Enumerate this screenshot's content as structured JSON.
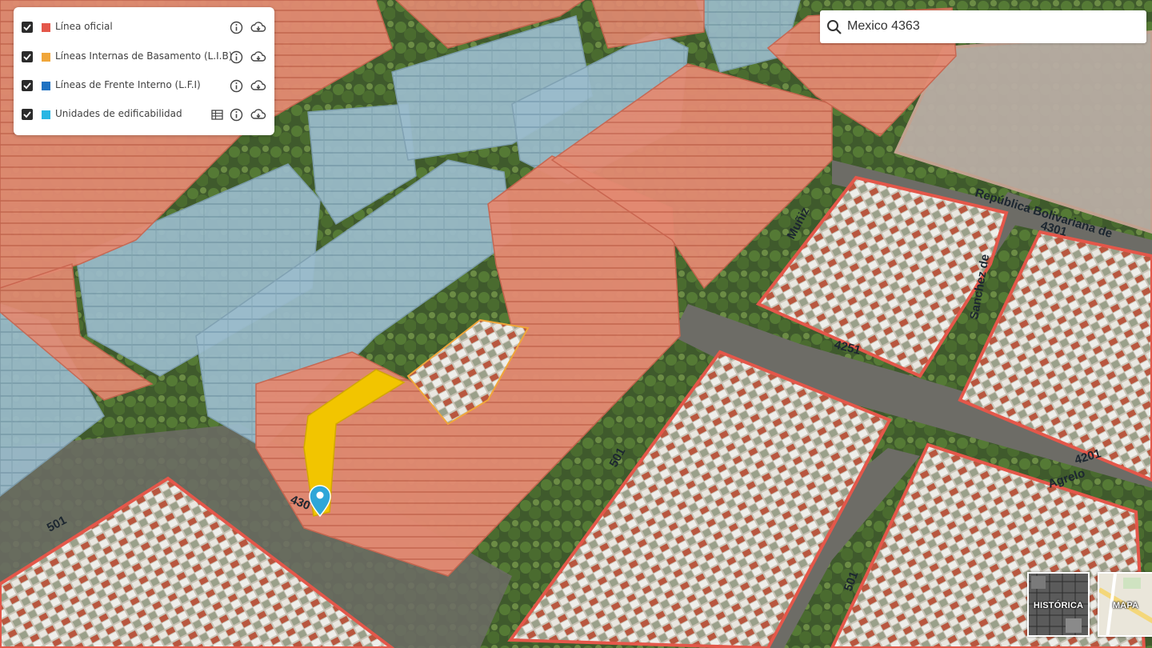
{
  "layers": [
    {
      "label": "Línea oficial",
      "color": "#e4574a",
      "checked": true,
      "icons": [
        "info-icon",
        "cloud-download-icon"
      ]
    },
    {
      "label": "Líneas Internas de Basamento (L.I.B)",
      "color": "#f0a63a",
      "checked": true,
      "icons": [
        "info-icon",
        "cloud-download-icon"
      ]
    },
    {
      "label": "Líneas de Frente Interno (L.F.I)",
      "color": "#1f72c2",
      "checked": true,
      "icons": [
        "info-icon",
        "cloud-download-icon"
      ]
    },
    {
      "label": "Unidades de edificabilidad",
      "color": "#29b6e3",
      "checked": true,
      "icons": [
        "table-icon",
        "info-icon",
        "cloud-download-icon"
      ]
    }
  ],
  "search": {
    "value": "Mexico 4363",
    "placeholder": ""
  },
  "basemaps": [
    {
      "label": "HISTÓRICA"
    },
    {
      "label": "MAPA"
    }
  ],
  "street_labels": {
    "av_republica": "República Bolivariana de",
    "agrelo": "Agrelo",
    "mexico_num": "4301",
    "lot_4251": "4251",
    "lot_4201": "4201",
    "lot_501_a": "501",
    "lot_501_b": "501",
    "lot_501_c": "501",
    "muniz": "Muñiz",
    "boedo_side": "Sanchez de",
    "lot_4300": "430"
  },
  "colors": {
    "envelope": "#e5826c",
    "glass": "#8fb4c6",
    "official_line": "#e4574a",
    "highlight": "#f2c500",
    "pin": "#2ea6d8"
  }
}
